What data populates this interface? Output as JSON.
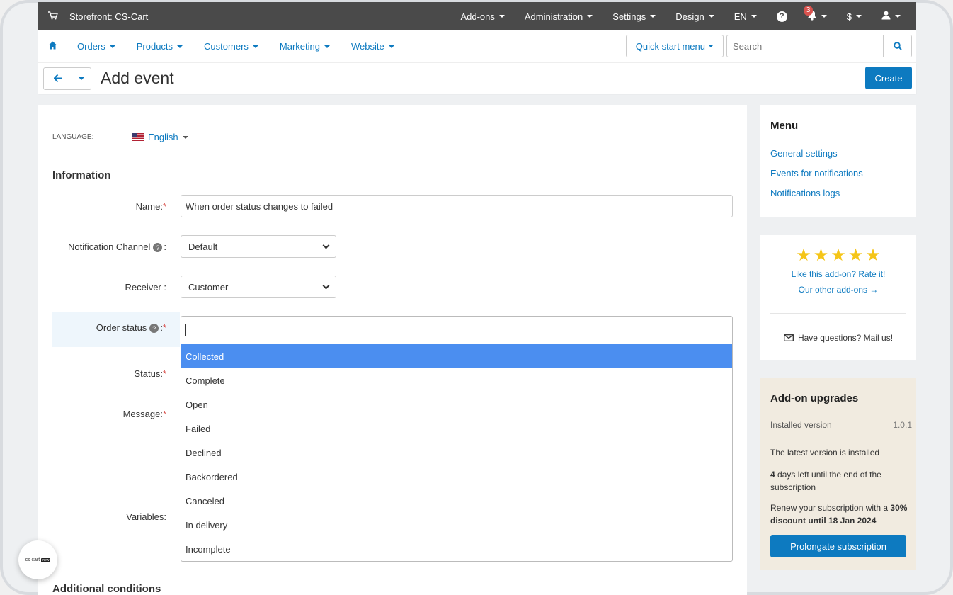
{
  "topbar": {
    "store": "Storefront: CS-Cart",
    "menus": [
      "Add-ons",
      "Administration",
      "Settings",
      "Design",
      "EN"
    ],
    "notifications_count": "3",
    "currency": "$"
  },
  "nav": {
    "items": [
      "Orders",
      "Products",
      "Customers",
      "Marketing",
      "Website"
    ],
    "quick_start": "Quick start menu",
    "search_placeholder": "Search"
  },
  "header": {
    "title": "Add event",
    "create_label": "Create"
  },
  "form": {
    "language_label": "LANGUAGE:",
    "language_value": "English",
    "info_title": "Information",
    "name_label": "Name:",
    "name_value": "When order status changes to failed",
    "channel_label": "Notification Channel",
    "channel_value": "Default",
    "receiver_label": "Receiver :",
    "receiver_value": "Customer",
    "order_status_label": "Order status",
    "status_label": "Status:",
    "message_label": "Message:",
    "variables_label": "Variables:",
    "additional_title": "Additional conditions",
    "order_status_options": [
      "Collected",
      "Complete",
      "Open",
      "Failed",
      "Declined",
      "Backordered",
      "Canceled",
      "In delivery",
      "Incomplete"
    ],
    "selected_option": "Collected"
  },
  "sidebar": {
    "menu_title": "Menu",
    "links": [
      "General settings",
      "Events for notifications",
      "Notifications logs"
    ],
    "rate_text": "Like this add-on? Rate it!",
    "other_addons": "Our other add-ons →",
    "mail_text": "Have questions? Mail us!",
    "stars": 5,
    "upgrades_title": "Add-on upgrades",
    "installed_label": "Installed version",
    "installed_version": "1.0.1",
    "latest_text": "The latest version is installed",
    "days_left_num": "4",
    "days_left_text": " days left until the end of the subscription",
    "renew_text": "Renew your subscription with a ",
    "renew_bold": "30% discount until 18 Jan 2024",
    "prolong_label": "Prolongate subscription"
  },
  "logo": {
    "text": "cs cart",
    "badge": "new"
  }
}
